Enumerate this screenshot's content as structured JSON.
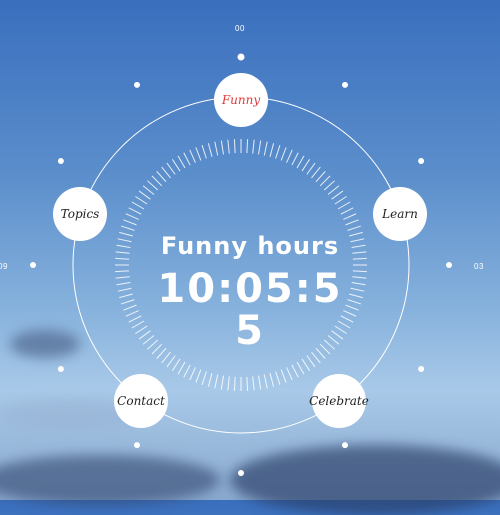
{
  "dial_labels": {
    "top": "00",
    "right": "03",
    "left": "09"
  },
  "nav": {
    "funny": "Funny",
    "learn": "Learn",
    "topics": "Topics",
    "contact": "Contact",
    "celebrate": "Celebrate"
  },
  "center": {
    "title": "Funny hours",
    "time": "10:05:55"
  },
  "colors": {
    "active_label": "#e03a3a"
  }
}
